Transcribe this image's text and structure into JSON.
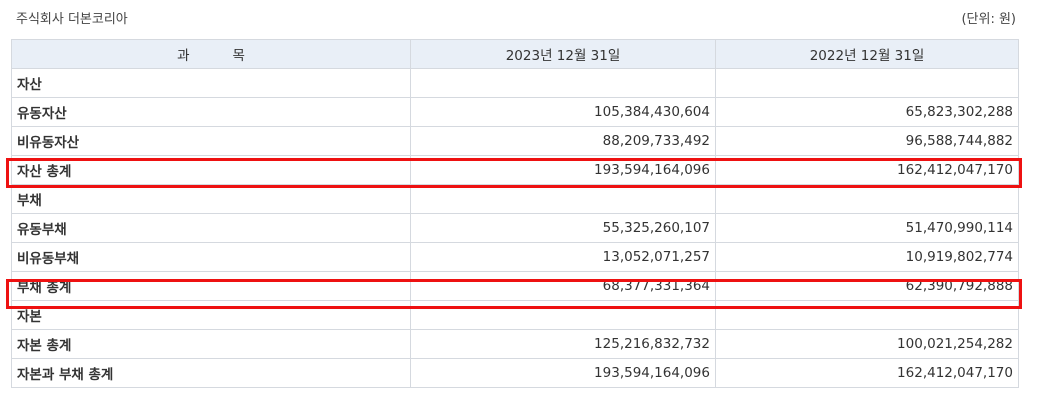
{
  "header": {
    "company": "주식회사 더본코리아",
    "unit": "(단위: 원)"
  },
  "table": {
    "columns": [
      "과          목",
      "2023년 12월 31일",
      "2022년 12월 31일"
    ],
    "rows": [
      {
        "label": "자산",
        "v2023": "",
        "v2022": ""
      },
      {
        "label": "유동자산",
        "v2023": "105,384,430,604",
        "v2022": "65,823,302,288"
      },
      {
        "label": "비유동자산",
        "v2023": "88,209,733,492",
        "v2022": "96,588,744,882"
      },
      {
        "label": "자산 총계",
        "v2023": "193,594,164,096",
        "v2022": "162,412,047,170"
      },
      {
        "label": "부채",
        "v2023": "",
        "v2022": ""
      },
      {
        "label": "유동부채",
        "v2023": "55,325,260,107",
        "v2022": "51,470,990,114"
      },
      {
        "label": "비유동부채",
        "v2023": "13,052,071,257",
        "v2022": "10,919,802,774"
      },
      {
        "label": "부채 총계",
        "v2023": "68,377,331,364",
        "v2022": "62,390,792,888"
      },
      {
        "label": "자본",
        "v2023": "",
        "v2022": ""
      },
      {
        "label": "자본 총계",
        "v2023": "125,216,832,732",
        "v2022": "100,021,254,282"
      },
      {
        "label": "자본과 부채 총계",
        "v2023": "193,594,164,096",
        "v2022": "162,412,047,170"
      }
    ]
  },
  "highlight_color": "#ee1111"
}
